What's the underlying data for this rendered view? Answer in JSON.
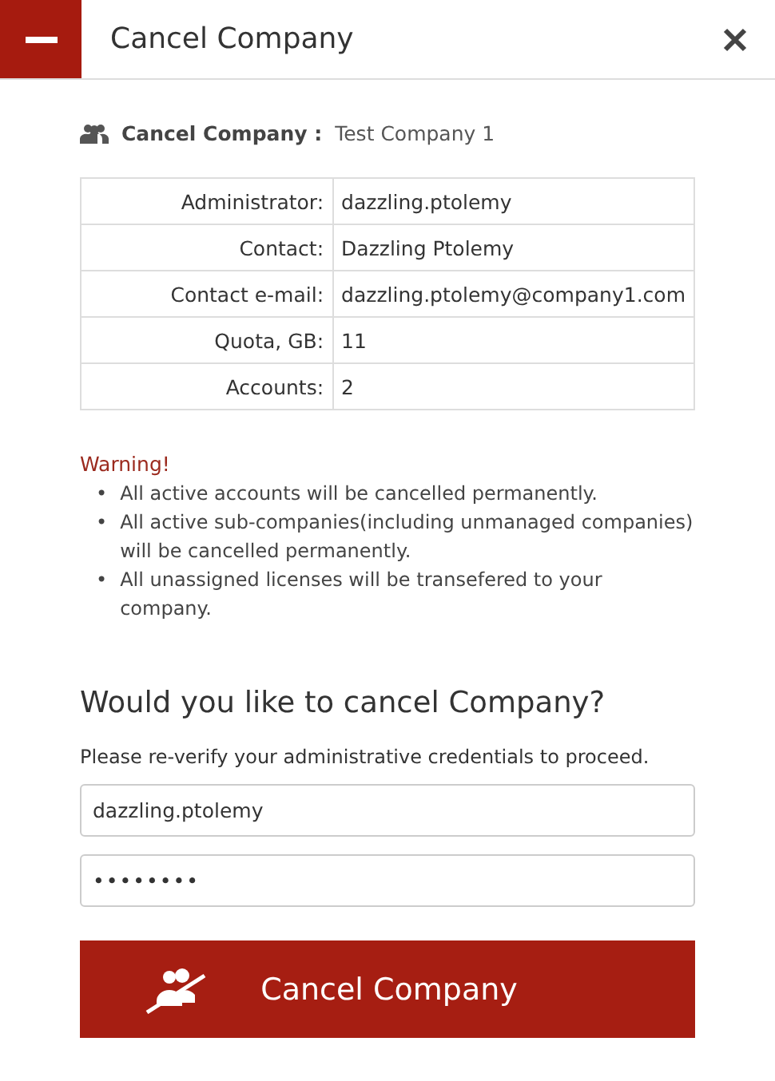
{
  "window": {
    "title": "Cancel Company"
  },
  "subheading": {
    "label": "Cancel Company :",
    "value": "Test Company 1"
  },
  "details": [
    {
      "label": "Administrator:",
      "value": "dazzling.ptolemy"
    },
    {
      "label": "Contact:",
      "value": "Dazzling Ptolemy"
    },
    {
      "label": "Contact e-mail:",
      "value": "dazzling.ptolemy@company1.com"
    },
    {
      "label": "Quota, GB:",
      "value": "11"
    },
    {
      "label": "Accounts:",
      "value": "2"
    }
  ],
  "warning": {
    "title": "Warning!",
    "marker": "•",
    "items": [
      "All active accounts will be cancelled permanently.",
      "All active sub-companies(including unmanaged companies) will be cancelled permanently.",
      "All unassigned licenses will be transefered to your company."
    ]
  },
  "question": "Would you like to cancel Company?",
  "instructions": "Please re-verify your administrative credentials to proceed.",
  "fields": [
    {
      "kind": "username",
      "value": "dazzling.ptolemy"
    },
    {
      "kind": "password",
      "value": "••••••••"
    }
  ],
  "submit": "Cancel Company"
}
